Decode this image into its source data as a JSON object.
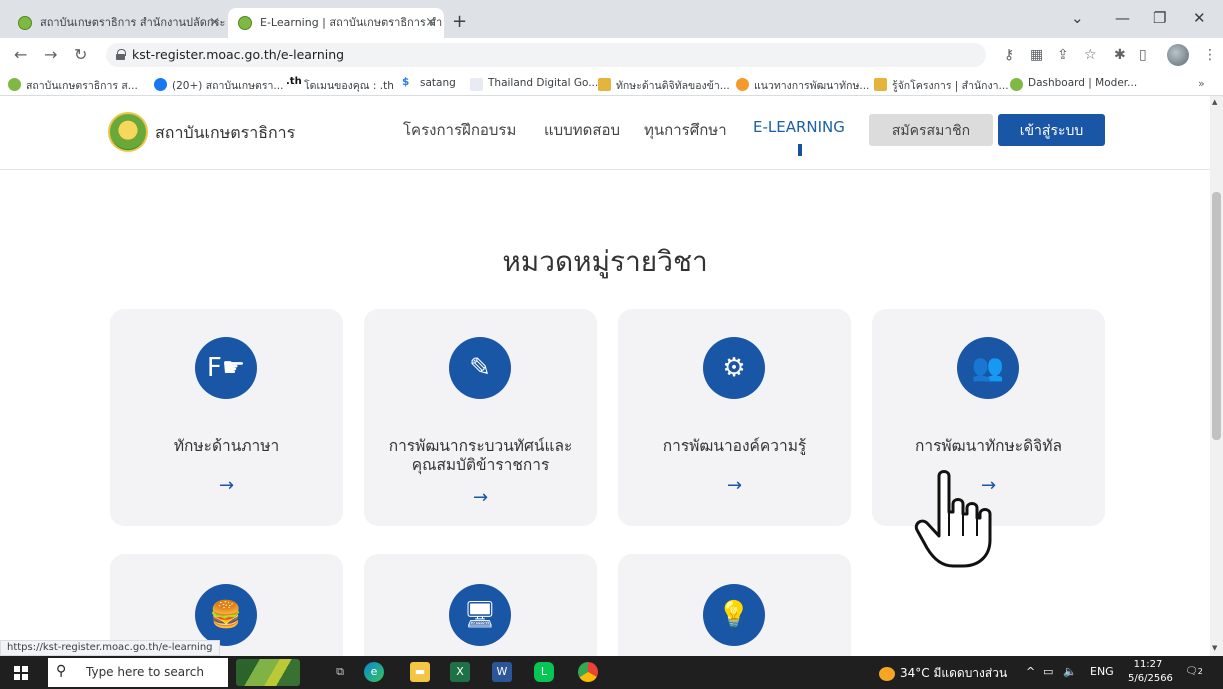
{
  "browser": {
    "tabs": [
      {
        "label": "สถาบันเกษตราธิการ สำนักงานปลัดกระ",
        "close": "×"
      },
      {
        "label": "E-Learning | สถาบันเกษตราธิการ สำ",
        "close": "×"
      }
    ],
    "new_tab": "+",
    "address": "kst-register.moac.go.th/e-learning",
    "bookmarks": [
      "สถาบันเกษตราธิการ ส...",
      "(20+) สถาบันเกษตรา...",
      "โดเมนของคุณ : .th",
      "satang",
      "Thailand Digital Go...",
      "ทักษะด้านดิจิทัลของข้า...",
      "แนวทางการพัฒนาทักษ...",
      "รู้จักโครงการ | สำนักงา...",
      "Dashboard | Moder..."
    ],
    "bookmarks_more": "»",
    "status_url": "https://kst-register.moac.go.th/e-learning"
  },
  "site": {
    "name": "สถาบันเกษตราธิการ",
    "nav": [
      "โครงการฝึกอบรม",
      "แบบทดสอบ",
      "ทุนการศึกษา",
      "E-LEARNING"
    ],
    "register": "สมัครสมาชิก",
    "login": "เข้าสู่ระบบ"
  },
  "section_title": "หมวดหมู่รายวิชา",
  "categories": [
    {
      "title": "ทักษะด้านภาษา",
      "icon": "language-icon",
      "arrow": "→"
    },
    {
      "title": "การพัฒนากระบวนทัศน์และคุณสมบัติข้าราชการ",
      "icon": "ruler-pencil-icon",
      "arrow": "→"
    },
    {
      "title": "การพัฒนาองค์ความรู้",
      "icon": "head-gears-icon",
      "arrow": "→"
    },
    {
      "title": "การพัฒนาทักษะดิจิทัล",
      "icon": "users-icon",
      "arrow": "→"
    },
    {
      "title": "",
      "icon": "food-drink-icon"
    },
    {
      "title": "",
      "icon": "monitor-icon"
    },
    {
      "title": "",
      "icon": "head-idea-icon"
    }
  ],
  "taskbar": {
    "search_placeholder": "Type here to search",
    "weather": "34°C  มีแดดบางส่วน",
    "lang": "ENG",
    "time": "11:27",
    "date": "5/6/2566",
    "notifications": "2"
  },
  "colors": {
    "brand_blue": "#1a56a6",
    "card_bg": "#f3f3f5"
  }
}
